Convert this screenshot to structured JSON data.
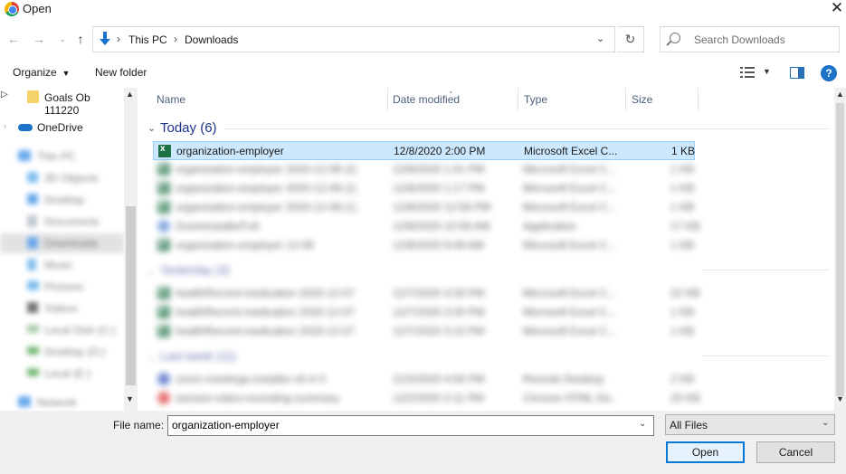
{
  "window": {
    "title": "Open"
  },
  "address": {
    "crumbs": [
      "This PC",
      "Downloads"
    ]
  },
  "search": {
    "placeholder": "Search Downloads"
  },
  "toolbar": {
    "organize": "Organize",
    "new_folder": "New folder"
  },
  "sidebar": {
    "items": [
      {
        "label": "Goals Ob 111220"
      },
      {
        "label": "OneDrive"
      },
      {
        "label": "This PC"
      },
      {
        "label": "3D Objects"
      },
      {
        "label": "Desktop"
      },
      {
        "label": "Documents"
      },
      {
        "label": "Downloads"
      },
      {
        "label": "Music"
      },
      {
        "label": "Pictures"
      },
      {
        "label": "Videos"
      },
      {
        "label": "Local Disk (C:)"
      },
      {
        "label": "Desktop (D:)"
      },
      {
        "label": "Local (E:)"
      },
      {
        "label": "Network"
      }
    ]
  },
  "columns": {
    "name": "Name",
    "date": "Date modified",
    "type": "Type",
    "size": "Size"
  },
  "groups": [
    {
      "label": "Today (6)"
    },
    {
      "label": "Yesterday (3)"
    },
    {
      "label": "Last week (11)"
    }
  ],
  "files": [
    {
      "name": "organization-employer",
      "date": "12/8/2020 2:00 PM",
      "type": "Microsoft Excel C...",
      "size": "1 KB"
    },
    {
      "name": "organization-employer 2020-12-08 (2)",
      "date": "12/8/2020 1:41 PM",
      "type": "Microsoft Excel C...",
      "size": "1 KB"
    },
    {
      "name": "organization-employer 2020-12-08 (1)",
      "date": "12/8/2020 1:17 PM",
      "type": "Microsoft Excel C...",
      "size": "1 KB"
    },
    {
      "name": "organization-employer 2020-12-08 (1)",
      "date": "12/8/2020 12:58 PM",
      "type": "Microsoft Excel C...",
      "size": "1 KB"
    },
    {
      "name": "ZoomInstallerFull",
      "date": "12/8/2020 10:56 AM",
      "type": "Application",
      "size": "17 KB"
    },
    {
      "name": "organization-employer 12-08",
      "date": "12/8/2020 9:49 AM",
      "type": "Microsoft Excel C...",
      "size": "1 KB"
    },
    {
      "name": "healthRecord-medication 2020-12-07 (2)",
      "date": "12/7/2020 3:26 PM",
      "type": "Microsoft Excel C...",
      "size": "22 KB"
    },
    {
      "name": "healthRecord-medication 2020-12-07 (1)",
      "date": "12/7/2020 3:20 PM",
      "type": "Microsoft Excel C...",
      "size": "1 KB"
    },
    {
      "name": "healthRecord-medication 2020-12-07",
      "date": "12/7/2020 3:10 PM",
      "type": "Microsoft Excel C...",
      "size": "1 KB"
    },
    {
      "name": "zoom-meetings-installer-v5-4-3",
      "date": "12/3/2020 4:56 PM",
      "type": "Remote Desktop",
      "size": "2 KB"
    },
    {
      "name": "session-video-recording-summary",
      "date": "12/2/2020 2:11 PM",
      "type": "Chrome HTML Do...",
      "size": "20 KB"
    }
  ],
  "bottom": {
    "file_name_label": "File name:",
    "file_name_value": "organization-employer",
    "file_type": "All Files",
    "open": "Open",
    "cancel": "Cancel"
  },
  "colors": {
    "selection": "#cce8ff",
    "accent": "#0078d7",
    "group_header": "#1e3287",
    "excel_green": "#1d7044"
  }
}
